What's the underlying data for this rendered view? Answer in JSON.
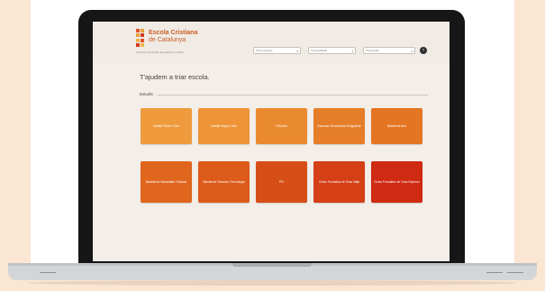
{
  "header": {
    "brand_line1": "Escola Cristiana",
    "brand_line2": "de Catalunya",
    "tagline": "Construïm una escola de qualitat per a tothom",
    "selects": [
      {
        "label": "Tria la comarca"
      },
      {
        "label": "Tria la població"
      },
      {
        "label": "Tria l'escola"
      }
    ]
  },
  "main": {
    "title": "T'ajudem a triar escola.",
    "section_label": "Estudis",
    "tiles": [
      {
        "label": "Infantil Primer Cicle",
        "color": "#ef9a3c"
      },
      {
        "label": "Infantil Segon Cicle",
        "color": "#ee9437"
      },
      {
        "label": "Primària",
        "color": "#ea8a30"
      },
      {
        "label": "Educació Secundària Obligatòria",
        "color": "#e67e29"
      },
      {
        "label": "Batxillerat Arts",
        "color": "#e47523"
      },
      {
        "label": "Batxillerat Humanitats i Socials",
        "color": "#e0661e"
      },
      {
        "label": "Batxillerat Ciències i Tecnologia",
        "color": "#dc5a1a"
      },
      {
        "label": "PFI",
        "color": "#d74e17"
      },
      {
        "label": "Cicles Formatius de Grau Mitjà",
        "color": "#d43f15"
      },
      {
        "label": "Cicles Formatius de Grau Superior",
        "color": "#cf2a12"
      }
    ]
  },
  "colors": {
    "background": "#fbe6d2",
    "accent": "#ca5b24",
    "screen": "#f3eee8"
  },
  "icons": {
    "logo": "escola-cristiana-logo",
    "go": "go-circle-icon"
  }
}
